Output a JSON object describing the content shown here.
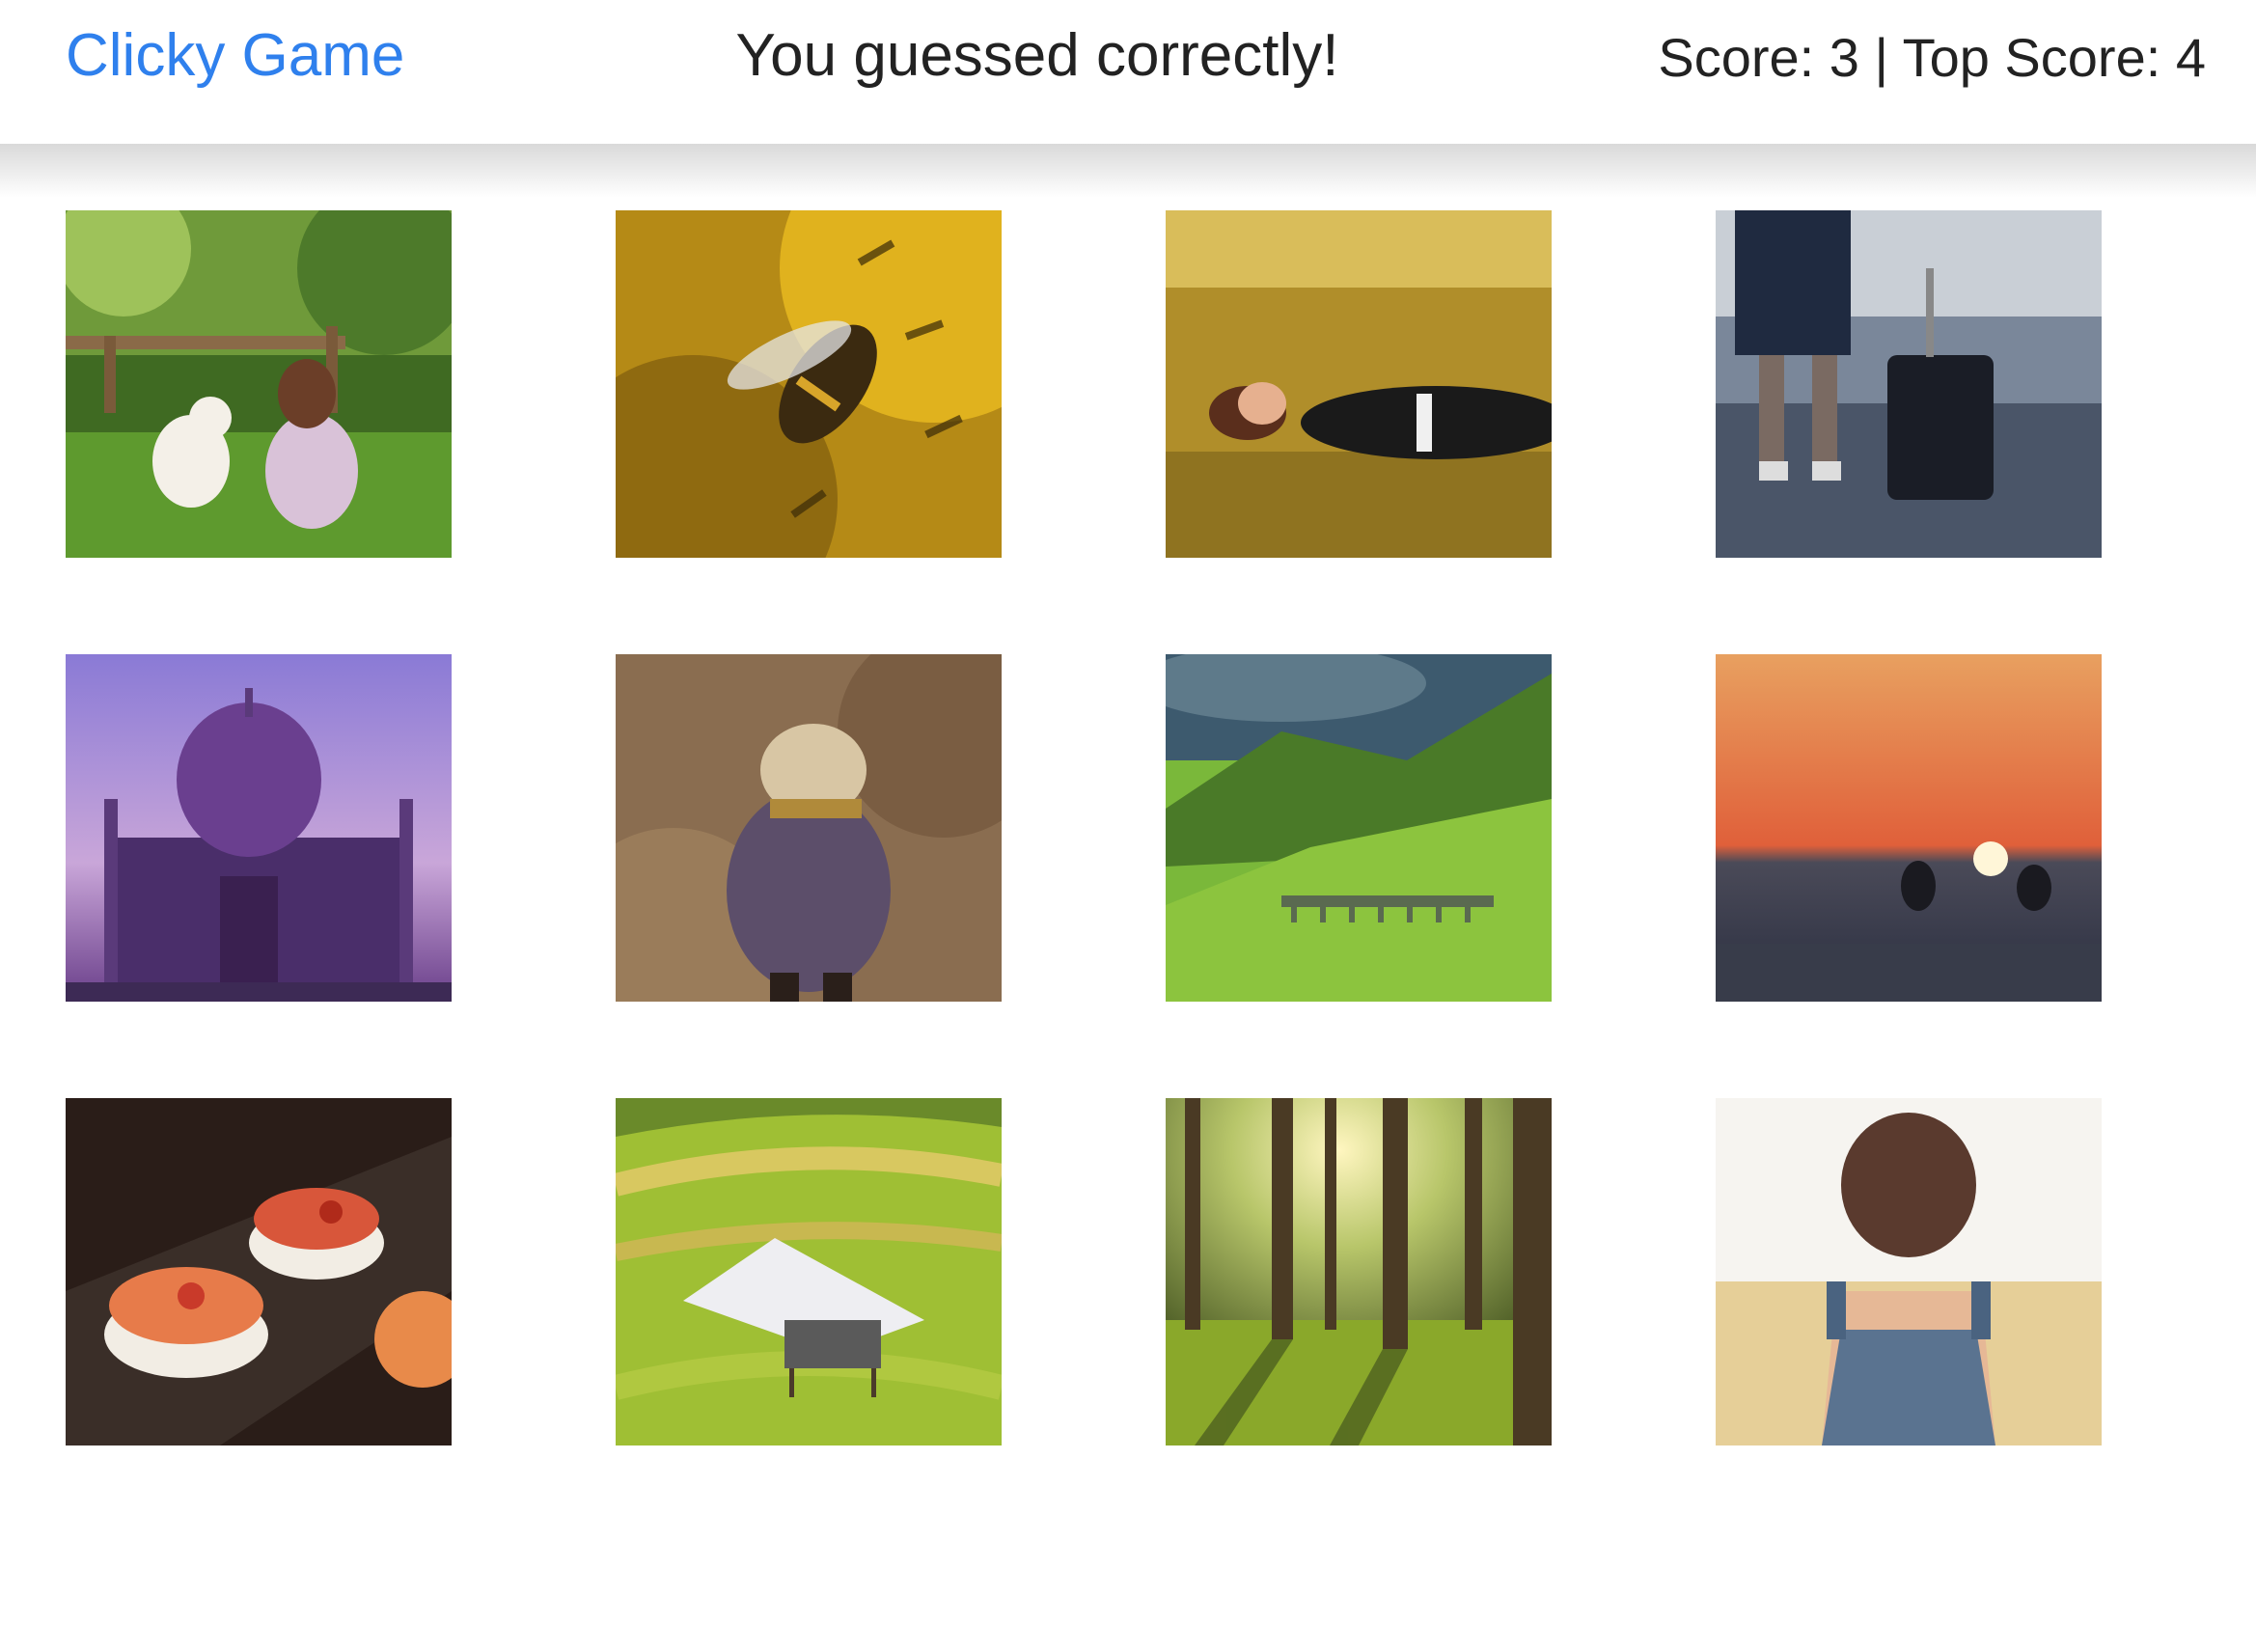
{
  "navbar": {
    "brand": "Clicky Game",
    "message": "You guessed correctly!",
    "score_label": "Score:",
    "score": 3,
    "separator": "|",
    "top_score_label": "Top Score:",
    "top_score": 4
  },
  "colors": {
    "brand": "#2f80ed",
    "text": "#222222"
  },
  "cards": [
    {
      "id": "girl-with-dog"
    },
    {
      "id": "bee-on-sunflower"
    },
    {
      "id": "woman-lying-in-grass"
    },
    {
      "id": "traveler-with-suitcase"
    },
    {
      "id": "taj-mahal"
    },
    {
      "id": "child-in-field"
    },
    {
      "id": "green-valley-viaduct"
    },
    {
      "id": "sunset-sea"
    },
    {
      "id": "sushi-platter"
    },
    {
      "id": "hut-on-rice-terraces"
    },
    {
      "id": "sunlit-forest"
    },
    {
      "id": "girl-in-overalls"
    }
  ]
}
